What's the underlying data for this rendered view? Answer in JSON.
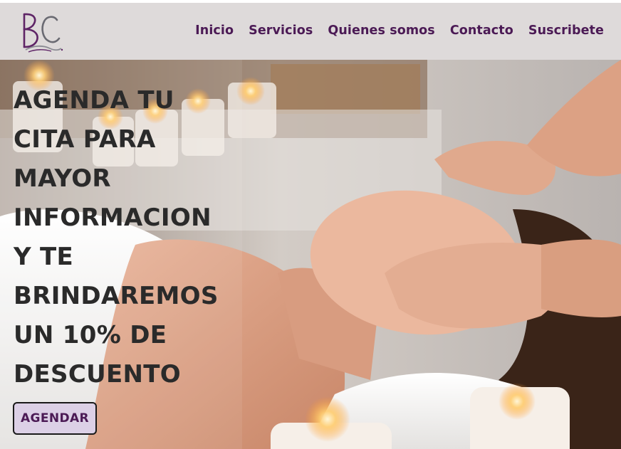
{
  "brand": {
    "logo_text": "BC",
    "logo_color": "#5e2466"
  },
  "nav": {
    "items": [
      {
        "label": "Inicio"
      },
      {
        "label": "Servicios"
      },
      {
        "label": "Quienes somos"
      },
      {
        "label": "Contacto"
      },
      {
        "label": "Suscribete"
      }
    ],
    "color": "#4b1a55",
    "background": "#dedada"
  },
  "hero": {
    "image": "spa-facial-massage-photo",
    "headline_lines": [
      "AGENDA TU",
      "CITA PARA",
      "MAYOR",
      "INFORMACION",
      "Y TE",
      "BRINDAREMOS",
      "UN 10% DE",
      "DESCUENTO"
    ],
    "cta_label": "AGENDAR",
    "cta_background": "#dcd0e6",
    "text_color": "#2a2a2a"
  }
}
